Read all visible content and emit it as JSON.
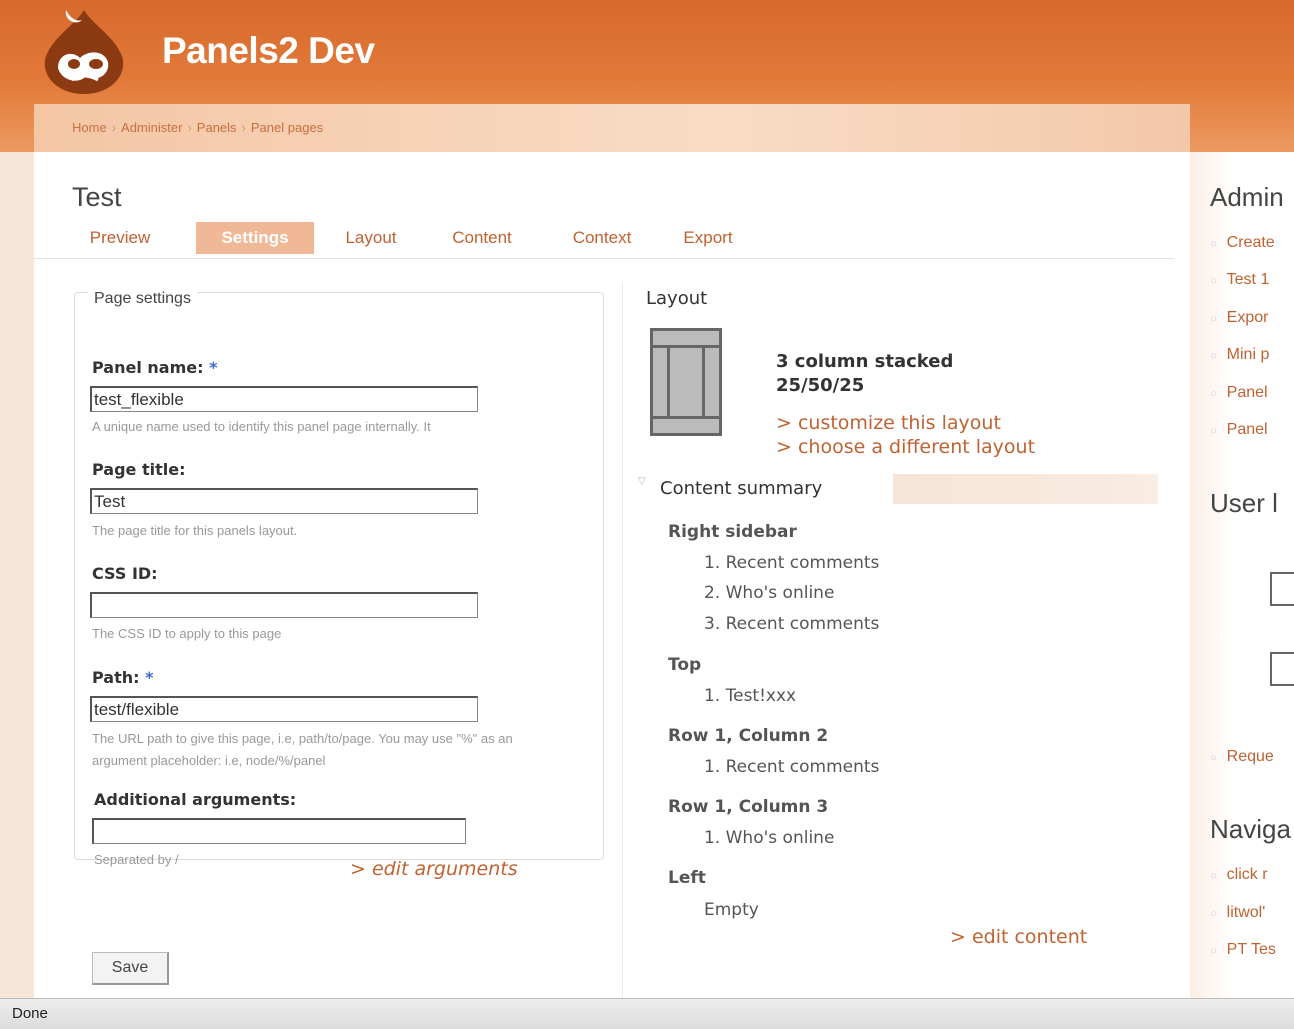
{
  "site": {
    "name": "Panels2 Dev"
  },
  "breadcrumb": [
    "Home",
    "Administer",
    "Panels",
    "Panel pages"
  ],
  "page": {
    "title": "Test"
  },
  "tabs": [
    "Preview",
    "Settings",
    "Layout",
    "Content",
    "Context",
    "Export"
  ],
  "active_tab": "Settings",
  "page_settings": {
    "legend": "Page settings",
    "panel_name": {
      "label": "Panel name: ",
      "required": "*",
      "value": "test_flexible",
      "description": "A unique name used to identify this panel page internally. It"
    },
    "page_title": {
      "label": "Page title:",
      "value": "Test",
      "description": "The page title for this panels layout."
    },
    "css_id": {
      "label": "CSS ID:",
      "value": "",
      "description": "The CSS ID to apply to this page"
    },
    "path": {
      "label": "Path: ",
      "required": "*",
      "value": "test/flexible",
      "description": "The URL path to give this page, i.e, path/to/page. You may use \"%\" as an argument placeholder: i.e, node/%/panel"
    },
    "additional_arguments": {
      "label": "Additional arguments:",
      "value": "",
      "description": "Separated by /"
    },
    "edit_arguments_link": "> edit arguments",
    "save_label": "Save"
  },
  "layout": {
    "heading": "Layout",
    "name_line1": "3 column stacked",
    "name_line2": "25/50/25",
    "customize_link": "> customize this layout",
    "choose_link": "> choose a different layout"
  },
  "content_summary": {
    "heading": "Content summary",
    "regions": [
      {
        "title": "Right sidebar",
        "items": [
          "1.  Recent comments",
          "2.  Who's online",
          "3.  Recent comments"
        ]
      },
      {
        "title": "Top",
        "items": [
          "1.  Test!xxx"
        ]
      },
      {
        "title": "Row 1, Column 2",
        "items": [
          "1.  Recent comments"
        ]
      },
      {
        "title": "Row 1, Column 3",
        "items": [
          "1.  Who's online"
        ]
      },
      {
        "title": "Left",
        "items": [
          "Empty"
        ]
      }
    ],
    "edit_content_link": "> edit content"
  },
  "sidebar": {
    "admin_title": "Admin",
    "admin_items": [
      "Create",
      "Test 1",
      "Expor",
      "Mini p",
      "Panel",
      "Panel"
    ],
    "user_title": "User l",
    "request_link": "Reque",
    "nav_title": "Naviga",
    "nav_items": [
      "click r",
      "litwol'",
      "PT Tes"
    ]
  },
  "status_bar": {
    "text": "Done"
  },
  "colors": {
    "header": "#e27a3a",
    "link": "#c06232",
    "active_tab": "#f0b896",
    "required": "#3a6bd6"
  }
}
